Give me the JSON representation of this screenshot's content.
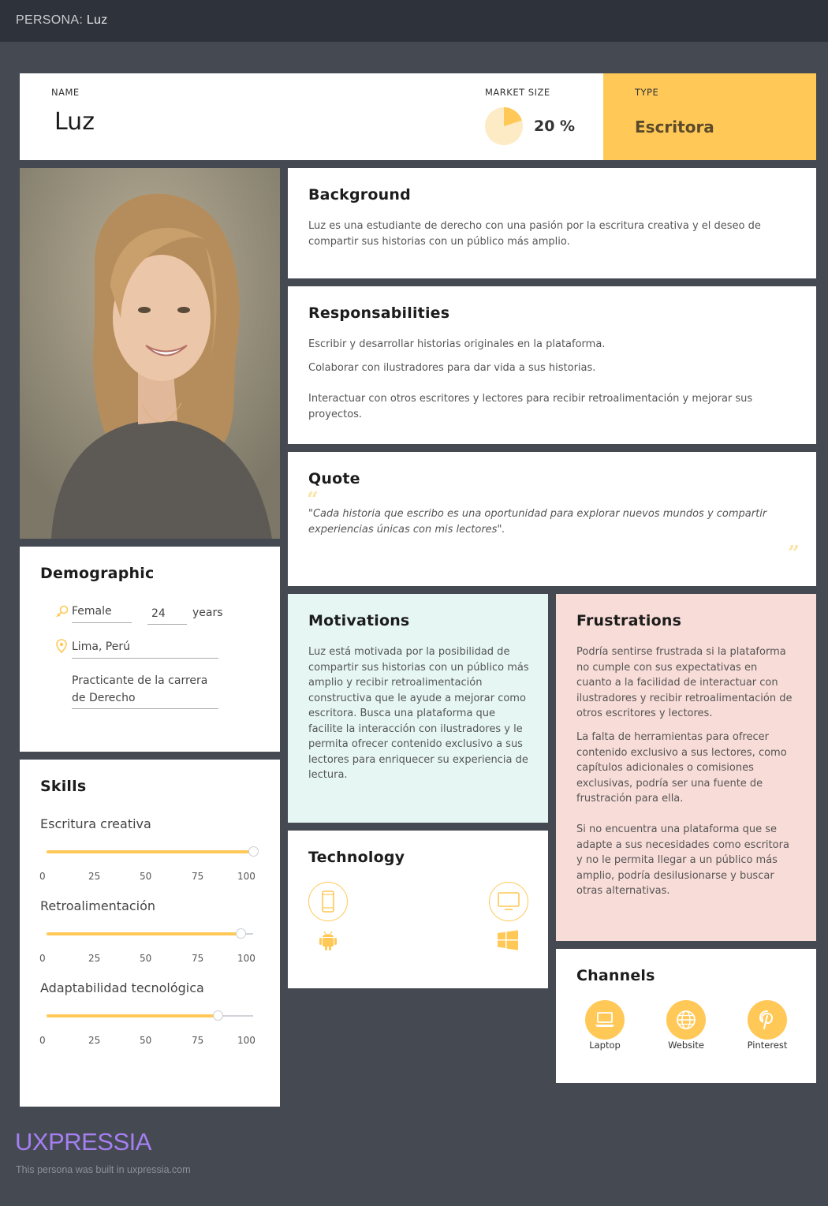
{
  "topbar": {
    "prefix": "PERSONA:",
    "name": "Luz"
  },
  "header": {
    "name_label": "NAME",
    "name": "Luz",
    "market_label": "MARKET SIZE",
    "market_value": "20 %",
    "market_fraction": 0.2,
    "type_label": "TYPE",
    "type": "Escritora"
  },
  "photo": {
    "icon": "persona-photo"
  },
  "background": {
    "title": "Background",
    "text": "Luz es una estudiante de derecho con una pasión por la escritura creativa y el deseo de compartir sus historias con un público más amplio."
  },
  "responsabilities": {
    "title": "Responsabilities",
    "items": [
      "Escribir y desarrollar historias originales en la plataforma.",
      "Colaborar con ilustradores para dar vida a sus historias.",
      "Interactuar con otros escritores y lectores para recibir retroalimentación y mejorar sus proyectos."
    ]
  },
  "quote": {
    "title": "Quote",
    "text": "\"Cada historia que escribo es una oportunidad para explorar nuevos mundos y compartir experiencias únicas con mis lectores\"."
  },
  "demographic": {
    "title": "Demographic",
    "gender": "Female",
    "age": "24",
    "age_unit": "years",
    "location": "Lima, Perú",
    "occupation": "Practicante de la carrera de Derecho"
  },
  "motivations": {
    "title": "Motivations",
    "text": "Luz está motivada por la posibilidad de compartir sus historias con un público más amplio y recibir retroalimentación constructiva que le ayude a mejorar como escritora. Busca una plataforma que facilite la interacción con ilustradores y le permita ofrecer contenido exclusivo a sus lectores para enriquecer su experiencia de lectura."
  },
  "frustrations": {
    "title": "Frustrations",
    "items": [
      "Podría sentirse frustrada si la plataforma no cumple con sus expectativas en cuanto a la facilidad de interactuar con ilustradores y recibir retroalimentación de otros escritores y lectores.",
      "La falta de herramientas para ofrecer contenido exclusivo a sus lectores, como capítulos adicionales o comisiones exclusivas, podría ser una fuente de frustración para ella.",
      "Si no encuentra una plataforma que se adapte a sus necesidades como escritora y no le permita llegar a un público más amplio, podría desilusionarse y buscar otras alternativas."
    ]
  },
  "skills": {
    "title": "Skills",
    "ticks": [
      "0",
      "25",
      "50",
      "75",
      "100"
    ],
    "items": [
      {
        "label": "Escritura creativa",
        "value": 100
      },
      {
        "label": "Retroalimentación",
        "value": 94
      },
      {
        "label": "Adaptabilidad tecnológica",
        "value": 83
      }
    ]
  },
  "technology": {
    "title": "Technology",
    "icons": [
      "smartphone-icon",
      "desktop-icon",
      "android-icon",
      "windows-icon"
    ]
  },
  "channels": {
    "title": "Channels",
    "items": [
      {
        "label": "Laptop",
        "icon": "laptop-icon"
      },
      {
        "label": "Website",
        "icon": "globe-icon"
      },
      {
        "label": "Pinterest",
        "icon": "pinterest-icon"
      }
    ]
  },
  "footer": {
    "brand": "UXPRESSIA",
    "note": "This persona was built in uxpressia.com"
  },
  "colors": {
    "accent": "#ffc857",
    "background": "#444952",
    "topbar": "#2e323a",
    "motivations_bg": "#e6f7f3",
    "frustrations_bg": "#f8dcd8",
    "brand": "#a57ff0"
  }
}
